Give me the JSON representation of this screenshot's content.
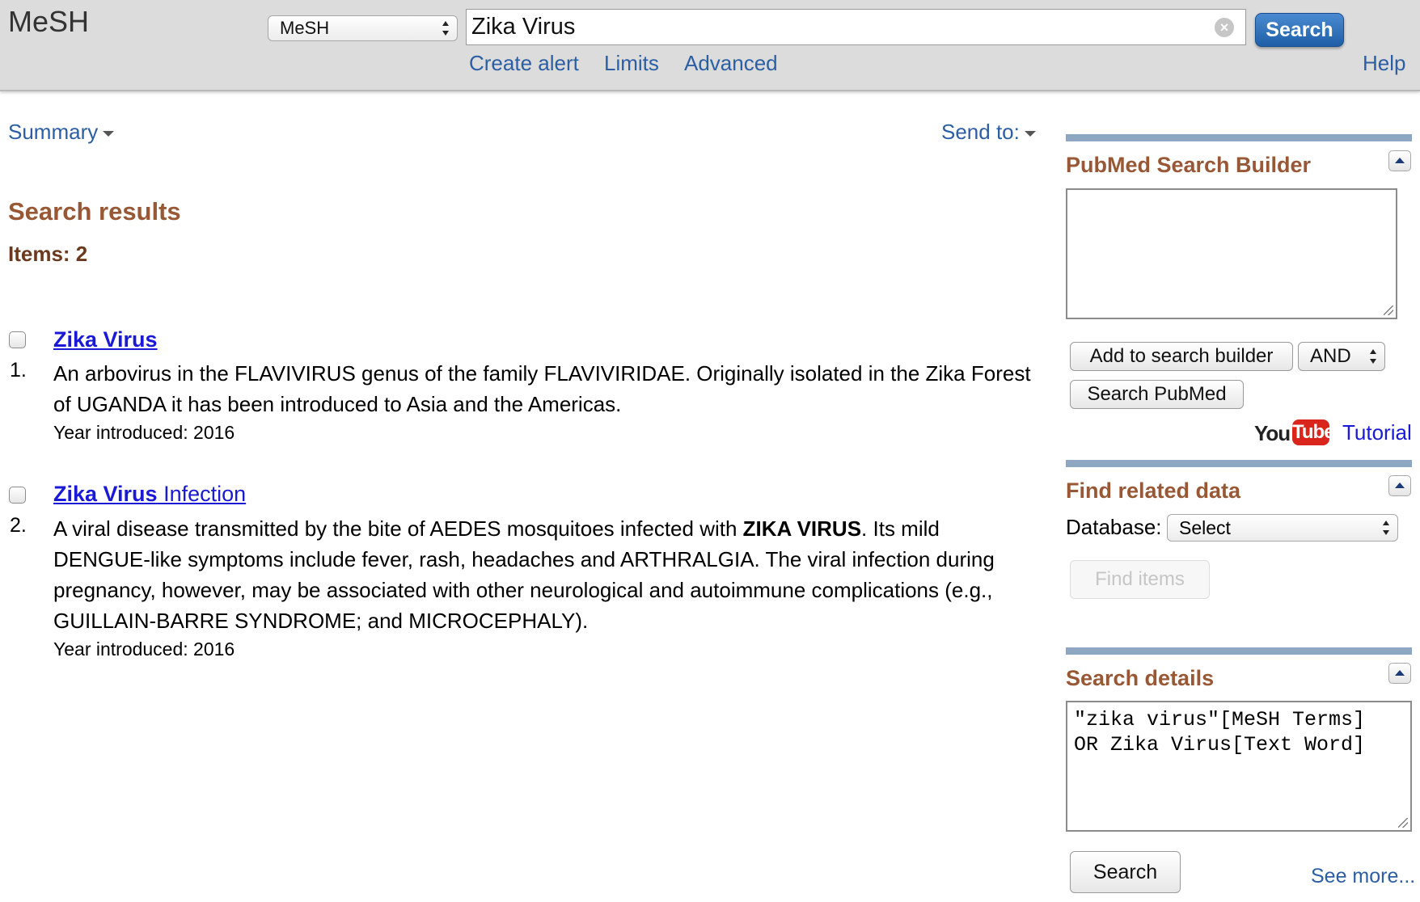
{
  "header": {
    "app_title": "MeSH",
    "database_select": "MeSH",
    "search_value": "Zika Virus",
    "search_button": "Search",
    "links": [
      "Create alert",
      "Limits",
      "Advanced"
    ],
    "help": "Help"
  },
  "toolbar": {
    "summary": "Summary",
    "send_to": "Send to:"
  },
  "results": {
    "title": "Search results",
    "count_label": "Items: 2",
    "items": [
      {
        "number": "1.",
        "title": "Zika Virus",
        "description": "An arbovirus in the FLAVIVIRUS genus of the family FLAVIVIRIDAE. Originally isolated in the Zika Forest of UGANDA it has been introduced to Asia and the Americas.",
        "year": "Year introduced: 2016"
      },
      {
        "number": "2.",
        "title_bold": "Zika Virus",
        "title_rest": " Infection",
        "description_before": "A viral disease transmitted by the bite of AEDES mosquitoes infected with ",
        "description_bold": "ZIKA VIRUS",
        "description_after": ". Its mild DENGUE-like symptoms include fever, rash, headaches and ARTHRALGIA. The viral infection during pregnancy, however, may be associated with other neurological and autoimmune complications (e.g., GUILLAIN-BARRE SYNDROME; and MICROCEPHALY).",
        "year": "Year introduced: 2016"
      }
    ]
  },
  "sidebar": {
    "builder": {
      "title": "PubMed Search Builder",
      "add_button": "Add to search builder",
      "operator": "AND",
      "search_pubmed_button": "Search PubMed",
      "youtube_you": "You",
      "youtube_tube": "Tube",
      "tutorial": "Tutorial"
    },
    "related": {
      "title": "Find related data",
      "database_label": "Database:",
      "database_value": "Select",
      "find_button": "Find items"
    },
    "details": {
      "title": "Search details",
      "query": "\"zika virus\"[MeSH Terms]\nOR Zika Virus[Text Word]",
      "search_button": "Search",
      "see_more": "See more..."
    }
  },
  "colors": {
    "header_bg": "#dcdcdc",
    "link_blue": "#2b5ea3",
    "result_link": "#1a1ad6",
    "section_brown": "#985735",
    "sidebar_bar": "#8ea8c4",
    "youtube_red": "#d9251c"
  }
}
